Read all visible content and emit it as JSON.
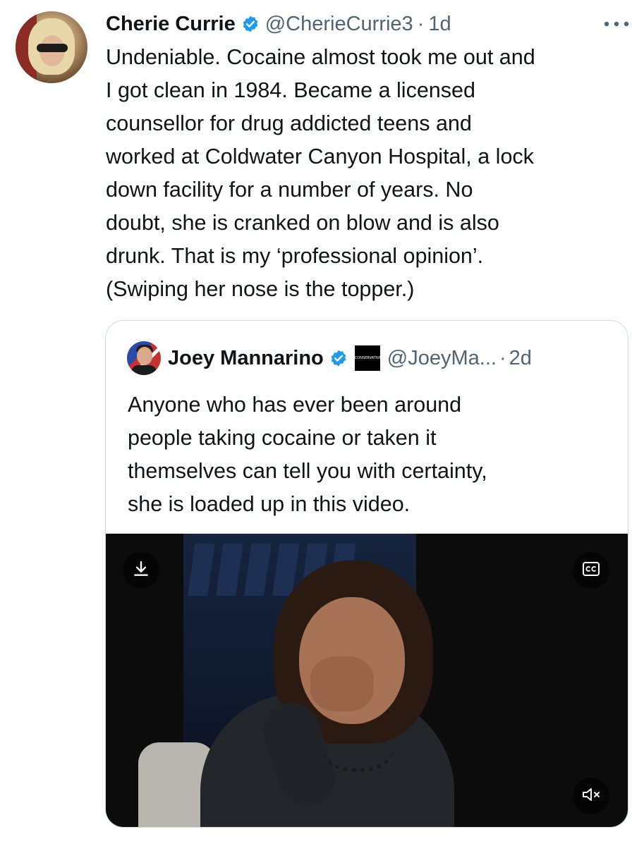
{
  "tweet": {
    "display_name": "Cherie Currie",
    "handle": "@CherieCurrie3",
    "separator": "·",
    "time": "1d",
    "text": "Undeniable. Cocaine almost took me out and\nI got clean in 1984. Became a licensed\ncounsellor for drug addicted teens and\nworked at Coldwater Canyon Hospital, a lock\ndown facility for a number of years. No\ndoubt, she is cranked on blow and is also\ndrunk. That is my ‘professional opinion’.\n(Swiping her nose is the topper.)",
    "icons": {
      "verified": "verified-badge-icon",
      "more": "more-options-icon"
    }
  },
  "quote": {
    "display_name": "Joey Mannarino",
    "affiliate_badge": "CONSERVATIVE",
    "handle": "@JoeyMa...",
    "separator": "·",
    "time": "2d",
    "text": "Anyone who has ever been around\npeople taking cocaine or taken it\nthemselves can tell you with certainty,\nshe is loaded up in this video.",
    "video": {
      "controls": [
        "download-icon",
        "closed-captions-icon",
        "muted-volume-icon"
      ]
    }
  },
  "colors": {
    "text_primary": "#0f1419",
    "text_secondary": "#536471",
    "verified_blue": "#1d9bf0",
    "border": "#cfd9de"
  }
}
